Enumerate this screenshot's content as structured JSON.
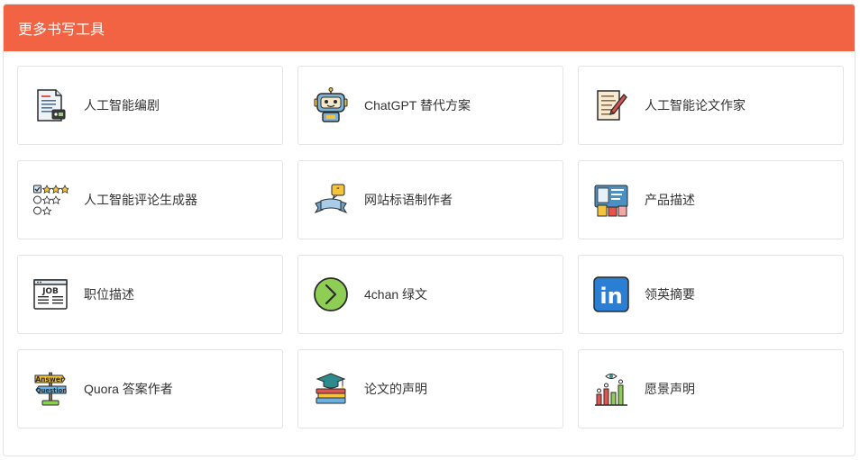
{
  "header": {
    "title": "更多书写工具"
  },
  "tools": [
    {
      "label": "人工智能编剧",
      "icon": "script-document-icon"
    },
    {
      "label": "ChatGPT 替代方案",
      "icon": "robot-icon"
    },
    {
      "label": "人工智能论文作家",
      "icon": "paper-pen-icon"
    },
    {
      "label": "人工智能评论生成器",
      "icon": "review-stars-icon"
    },
    {
      "label": "网站标语制作者",
      "icon": "slogan-banner-icon"
    },
    {
      "label": "产品描述",
      "icon": "product-card-icon"
    },
    {
      "label": "职位描述",
      "icon": "job-listing-icon"
    },
    {
      "label": "4chan 绿文",
      "icon": "greentext-arrow-icon"
    },
    {
      "label": "领英摘要",
      "icon": "linkedin-icon"
    },
    {
      "label": "Quora 答案作者",
      "icon": "answer-question-sign-icon"
    },
    {
      "label": "论文的声明",
      "icon": "books-graduation-cap-icon"
    },
    {
      "label": "愿景声明",
      "icon": "vision-chart-icon"
    }
  ],
  "icon_text": {
    "job": "JOB",
    "in": "in",
    "answer": "Answer",
    "question": "Question"
  },
  "colors": {
    "header_bg": "#f16342",
    "header_text": "#ffffff",
    "card_border": "#e4e4e4"
  }
}
